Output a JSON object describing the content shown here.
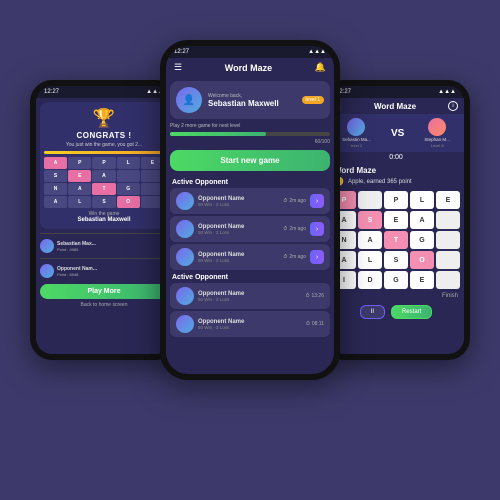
{
  "app": {
    "title": "Word Maze"
  },
  "left_phone": {
    "status_time": "12:27",
    "congrats_title": "CONGRATS !",
    "congrats_sub": "You just win the game, you got 2...",
    "win_text": "Win the game",
    "player_name": "Sebastian Maxwell",
    "opponent1_name": "Sebastian Max...",
    "opponent1_points": "Point : 4985",
    "opponent2_name": "Opponent Nam...",
    "opponent2_points": "Point : 6548",
    "play_more_label": "Play More",
    "back_link": "Back to home screen"
  },
  "center_phone": {
    "status_time": "12:27",
    "header_title": "Word Maze",
    "welcome_back": "Welcome back,",
    "user_name": "Sebastian Maxwell",
    "level": "level 1",
    "play_more_text": "Play 2 more game for next level",
    "progress_value": 60,
    "progress_label": "60/100",
    "start_btn": "Start new game",
    "active_opponent_label": "Active Opponent",
    "opponents": [
      {
        "name": "Opponent Name",
        "sub": "50 Win · 2 Loss",
        "time": "2m ago"
      },
      {
        "name": "Opponent Name",
        "sub": "50 Win · 2 Loss",
        "time": "2m ago"
      },
      {
        "name": "Opponent Name",
        "sub": "50 Win · 2 Loss",
        "time": "2m ago"
      }
    ],
    "active_opponent_label2": "Active Opponent",
    "opponents2": [
      {
        "name": "Opponent Name",
        "sub": "50 Win · 2 Loss",
        "time": "13:26"
      },
      {
        "name": "Opponent Name",
        "sub": "50 Win · 2 Loss",
        "time": "08:11"
      }
    ]
  },
  "right_phone": {
    "status_time": "12:27",
    "header_title": "Word Maze",
    "player1_name": "Sebastin Ma...",
    "player1_level": "level 2",
    "player2_name": "Stephan M...",
    "player2_level": "Level 8",
    "vs_text": "VS",
    "timer": "0:00",
    "maze_title": "Word Maze",
    "score_text": "Apple, earned 365 point",
    "grid_letters": [
      "P",
      "",
      "P",
      "L",
      "E",
      "A",
      "S",
      "E",
      "A",
      "",
      "N",
      "A",
      "T",
      "G",
      "",
      "A",
      "L",
      "S",
      "O",
      "",
      "I",
      "D",
      "G",
      "E",
      ""
    ],
    "finish_label": "Finish",
    "pause_label": "II",
    "restart_label": "Restart"
  }
}
